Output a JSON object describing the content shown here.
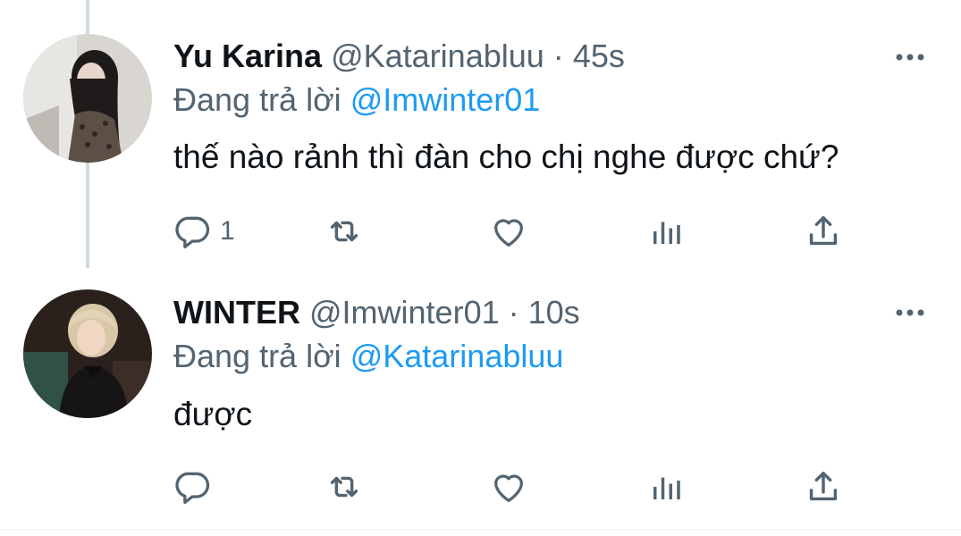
{
  "tweets": [
    {
      "display_name": "Yu Karina",
      "handle": "@Katarinabluu",
      "separator": "·",
      "time": "45s",
      "reply_prefix": "Đang trả lời",
      "reply_to": "@Imwinter01",
      "text": "thế nào rảnh thì đàn cho chị nghe được chứ?",
      "reply_count": "1",
      "avatar_icon": "user-avatar-photo"
    },
    {
      "display_name": "WINTER",
      "handle": "@Imwinter01",
      "separator": "·",
      "time": "10s",
      "reply_prefix": "Đang trả lời",
      "reply_to": "@Katarinabluu",
      "text": "được",
      "reply_count": "",
      "avatar_icon": "user-avatar-photo"
    }
  ],
  "icons": {
    "reply": "reply-icon",
    "retweet": "retweet-icon",
    "like": "heart-icon",
    "analytics": "analytics-icon",
    "share": "share-icon",
    "more": "more-icon"
  },
  "colors": {
    "text": "#0f1419",
    "secondary": "#536471",
    "link": "#1d9bf0",
    "thread_line": "#cfd9de"
  }
}
